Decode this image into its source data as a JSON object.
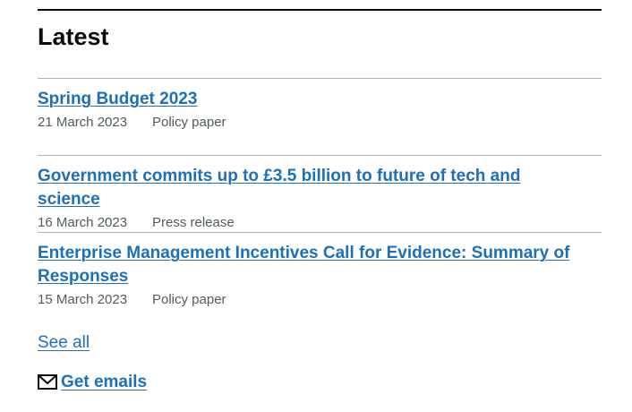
{
  "section": {
    "title": "Latest"
  },
  "items": [
    {
      "title": "Spring Budget 2023",
      "date": "21 March 2023",
      "type": "Policy paper"
    },
    {
      "title": "Government commits up to £3.5 billion to future of tech and science",
      "date": "16 March 2023",
      "type": "Press release"
    },
    {
      "title": "Enterprise Management Incentives Call for Evidence: Summary of Responses",
      "date": "15 March 2023",
      "type": "Policy paper"
    }
  ],
  "links": {
    "see_all": "See all",
    "get_emails": "Get emails"
  },
  "icons": {
    "mail": "mail-icon"
  },
  "colors": {
    "link": "#1d70b8",
    "text": "#0b0c0c",
    "meta": "#505a5f",
    "divider": "#b1b4b6"
  }
}
